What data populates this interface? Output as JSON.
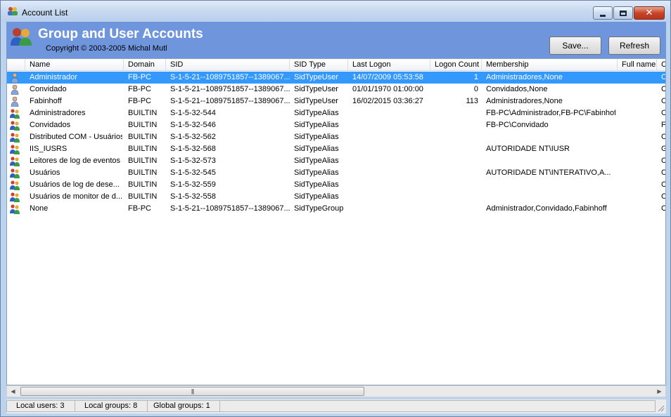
{
  "window": {
    "title": "Account List"
  },
  "banner": {
    "title": "Group and User Accounts",
    "copyright": "Copyright © 2003-2005 Michal Mutl",
    "save_label": "Save...",
    "refresh_label": "Refresh"
  },
  "columns": [
    "Name",
    "Domain",
    "SID",
    "SID Type",
    "Last Logon",
    "Logon Count",
    "Membership",
    "Full name",
    "C"
  ],
  "rows": [
    {
      "icon": "user-icon",
      "name": "Administrador",
      "domain": "FB-PC",
      "sid": "S-1-5-21--1089751857--1389067...",
      "sid_type": "SidTypeUser",
      "last_logon": "14/07/2009 05:53:58",
      "logon_count": "1",
      "membership": "Administradores,None",
      "full_name": "",
      "c": "C",
      "selected": true
    },
    {
      "icon": "user-icon",
      "name": "Convidado",
      "domain": "FB-PC",
      "sid": "S-1-5-21--1089751857--1389067...",
      "sid_type": "SidTypeUser",
      "last_logon": "01/01/1970 01:00:00",
      "logon_count": "0",
      "membership": "Convidados,None",
      "full_name": "",
      "c": "C",
      "selected": false
    },
    {
      "icon": "user-icon",
      "name": "Fabinhoff",
      "domain": "FB-PC",
      "sid": "S-1-5-21--1089751857--1389067...",
      "sid_type": "SidTypeUser",
      "last_logon": "16/02/2015 03:36:27",
      "logon_count": "113",
      "membership": "Administradores,None",
      "full_name": "",
      "c": "C",
      "selected": false
    },
    {
      "icon": "group-icon",
      "name": "Administradores",
      "domain": "BUILTIN",
      "sid": "S-1-5-32-544",
      "sid_type": "SidTypeAlias",
      "last_logon": "",
      "logon_count": "",
      "membership": "FB-PC\\Administrador,FB-PC\\Fabinhoff",
      "full_name": "",
      "c": "C",
      "selected": false
    },
    {
      "icon": "group-icon",
      "name": "Convidados",
      "domain": "BUILTIN",
      "sid": "S-1-5-32-546",
      "sid_type": "SidTypeAlias",
      "last_logon": "",
      "logon_count": "",
      "membership": "FB-PC\\Convidado",
      "full_name": "",
      "c": "F",
      "selected": false
    },
    {
      "icon": "group-icon",
      "name": "Distributed COM - Usuários",
      "domain": "BUILTIN",
      "sid": "S-1-5-32-562",
      "sid_type": "SidTypeAlias",
      "last_logon": "",
      "logon_count": "",
      "membership": "",
      "full_name": "",
      "c": "C",
      "selected": false
    },
    {
      "icon": "group-icon",
      "name": "IIS_IUSRS",
      "domain": "BUILTIN",
      "sid": "S-1-5-32-568",
      "sid_type": "SidTypeAlias",
      "last_logon": "",
      "logon_count": "",
      "membership": "AUTORIDADE NT\\IUSR",
      "full_name": "",
      "c": "G",
      "selected": false
    },
    {
      "icon": "group-icon",
      "name": "Leitores de log de eventos",
      "domain": "BUILTIN",
      "sid": "S-1-5-32-573",
      "sid_type": "SidTypeAlias",
      "last_logon": "",
      "logon_count": "",
      "membership": "",
      "full_name": "",
      "c": "C",
      "selected": false
    },
    {
      "icon": "group-icon",
      "name": "Usuários",
      "domain": "BUILTIN",
      "sid": "S-1-5-32-545",
      "sid_type": "SidTypeAlias",
      "last_logon": "",
      "logon_count": "",
      "membership": "AUTORIDADE NT\\INTERATIVO,A...",
      "full_name": "",
      "c": "C",
      "selected": false
    },
    {
      "icon": "group-icon",
      "name": "Usuários de log de dese...",
      "domain": "BUILTIN",
      "sid": "S-1-5-32-559",
      "sid_type": "SidTypeAlias",
      "last_logon": "",
      "logon_count": "",
      "membership": "",
      "full_name": "",
      "c": "C",
      "selected": false
    },
    {
      "icon": "group-icon",
      "name": "Usuários de monitor de d...",
      "domain": "BUILTIN",
      "sid": "S-1-5-32-558",
      "sid_type": "SidTypeAlias",
      "last_logon": "",
      "logon_count": "",
      "membership": "",
      "full_name": "",
      "c": "C",
      "selected": false
    },
    {
      "icon": "group-icon",
      "name": "None",
      "domain": "FB-PC",
      "sid": "S-1-5-21--1089751857--1389067...",
      "sid_type": "SidTypeGroup",
      "last_logon": "",
      "logon_count": "",
      "membership": "Administrador,Convidado,Fabinhoff",
      "full_name": "",
      "c": "C",
      "selected": false
    }
  ],
  "status": {
    "local_users": "Local users: 3",
    "local_groups": "Local groups: 8",
    "global_groups": "Global groups: 1"
  },
  "colors": {
    "banner": "#6f95dc",
    "selection": "#3399ff"
  }
}
